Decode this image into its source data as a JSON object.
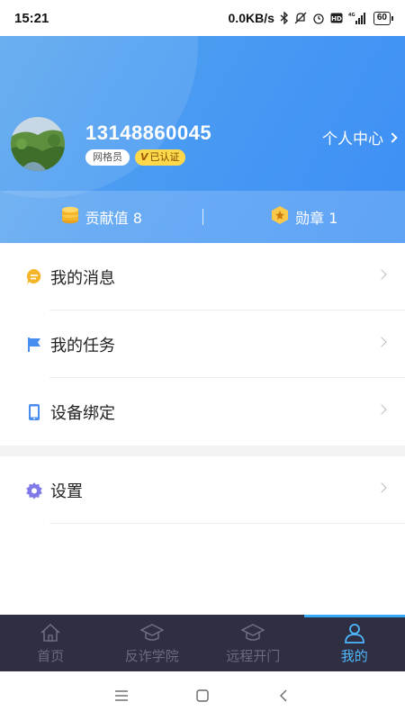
{
  "status_bar": {
    "time": "15:21",
    "net_speed": "0.0KB/s",
    "signal_label": "4G",
    "battery": "60"
  },
  "profile": {
    "phone": "13148860045",
    "role_tag": "网格员",
    "verified_tag": "已认证",
    "verified_mark": "V",
    "personal_center": "个人中心"
  },
  "stats": {
    "contribution": "贡献值 8",
    "medal": "勋章 1"
  },
  "menu": {
    "messages": "我的消息",
    "tasks": "我的任务",
    "device_binding": "设备绑定",
    "settings": "设置"
  },
  "bottom_nav": {
    "items": [
      {
        "label": "首页",
        "icon": "home-icon"
      },
      {
        "label": "反诈学院",
        "icon": "graduation-cap-icon"
      },
      {
        "label": "远程开门",
        "icon": "graduation-cap-icon"
      },
      {
        "label": "我的",
        "icon": "user-icon"
      }
    ],
    "active_index": 3
  },
  "colors": {
    "header": "#4a9bf2",
    "nav_bg": "#2f2f43",
    "nav_active": "#4fb8ff",
    "accent_yellow": "#f5b52a"
  }
}
